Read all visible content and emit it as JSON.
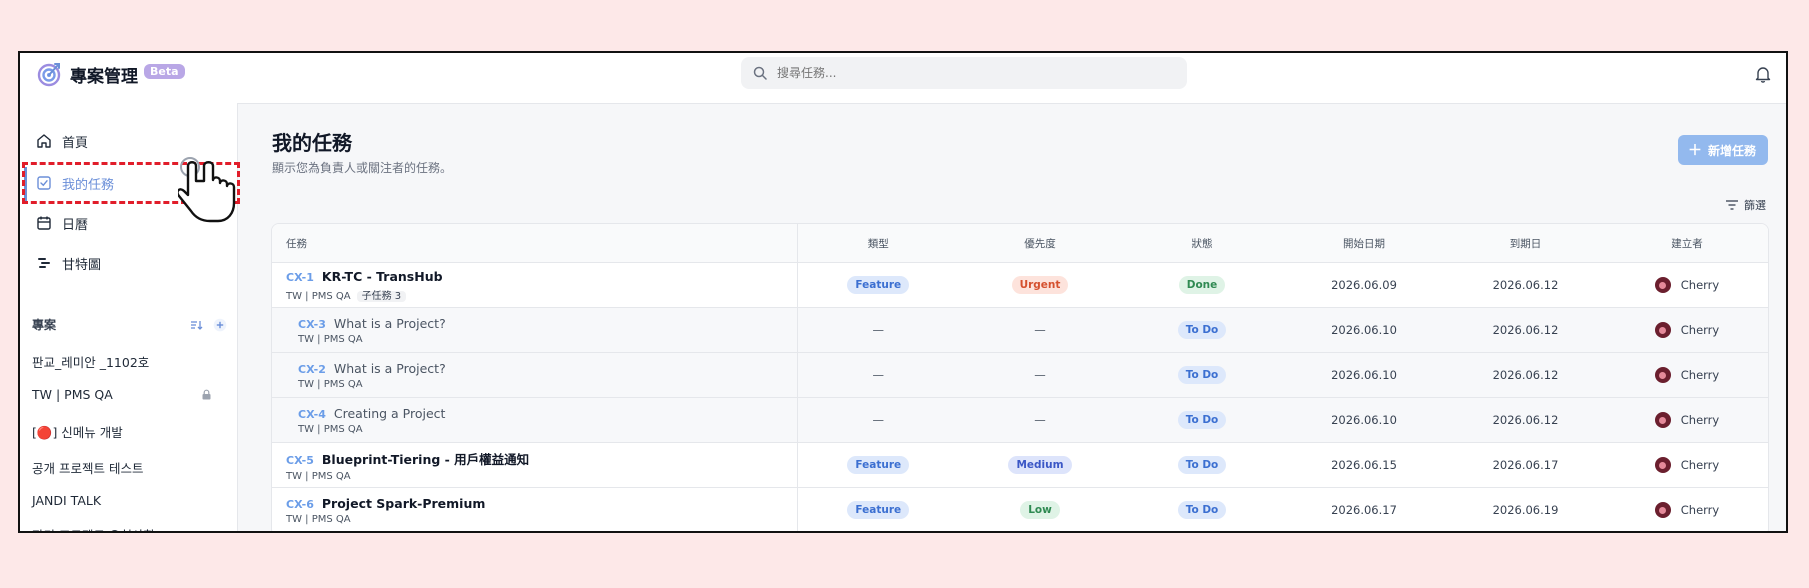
{
  "header": {
    "app_title": "專案管理",
    "beta_label": "Beta",
    "search_placeholder": "搜尋任務..."
  },
  "sidebar": {
    "nav": [
      {
        "label": "首頁",
        "icon": "home-icon"
      },
      {
        "label": "我的任務",
        "icon": "checkbox-icon",
        "active": true
      },
      {
        "label": "日曆",
        "icon": "calendar-icon"
      },
      {
        "label": "甘特圖",
        "icon": "gantt-icon"
      }
    ],
    "projects_title": "專案",
    "projects": [
      {
        "label": "판교_레미안 _1102호"
      },
      {
        "label": "TW | PMS QA",
        "locked": true
      },
      {
        "label": "[🔴] 신메뉴 개발"
      },
      {
        "label": "공개 프로젝트 테스트"
      },
      {
        "label": "JANDI TALK"
      },
      {
        "label": "잔디 프로젝트 요청사항"
      }
    ]
  },
  "main": {
    "title": "我的任務",
    "subtitle": "顯示您為負責人或關注者的任務。",
    "add_button": "新增任務",
    "filter_label": "篩選",
    "columns": [
      "任務",
      "類型",
      "優先度",
      "狀態",
      "開始日期",
      "到期日",
      "建立者"
    ],
    "rows": [
      {
        "id": "CX-1",
        "name": "KR-TC - TransHub",
        "meta": "TW | PMS QA",
        "subtasks": "子任務 3",
        "type": "Feature",
        "priority": "Urgent",
        "status": "Done",
        "start": "2026.06.09",
        "due": "2026.06.12",
        "creator": "Cherry",
        "sub": false
      },
      {
        "id": "CX-3",
        "name": "What is a Project?",
        "meta": "TW | PMS QA",
        "type": "—",
        "priority": "—",
        "status": "To Do",
        "start": "2026.06.10",
        "due": "2026.06.12",
        "creator": "Cherry",
        "sub": true
      },
      {
        "id": "CX-2",
        "name": "What is a Project?",
        "meta": "TW | PMS QA",
        "type": "—",
        "priority": "—",
        "status": "To Do",
        "start": "2026.06.10",
        "due": "2026.06.12",
        "creator": "Cherry",
        "sub": true
      },
      {
        "id": "CX-4",
        "name": "Creating a Project",
        "meta": "TW | PMS QA",
        "type": "—",
        "priority": "—",
        "status": "To Do",
        "start": "2026.06.10",
        "due": "2026.06.12",
        "creator": "Cherry",
        "sub": true
      },
      {
        "id": "CX-5",
        "name": "Blueprint-Tiering - 用戶權益通知",
        "meta": "TW | PMS QA",
        "type": "Feature",
        "priority": "Medium",
        "status": "To Do",
        "start": "2026.06.15",
        "due": "2026.06.17",
        "creator": "Cherry",
        "sub": false
      },
      {
        "id": "CX-6",
        "name": "Project Spark-Premium",
        "meta": "TW | PMS QA",
        "type": "Feature",
        "priority": "Low",
        "status": "To Do",
        "start": "2026.06.17",
        "due": "2026.06.19",
        "creator": "Cherry",
        "sub": false
      }
    ]
  },
  "colors": {
    "accent": "#6b8fd8",
    "highlight": "#e11d2a",
    "background": "#fde8e8"
  }
}
